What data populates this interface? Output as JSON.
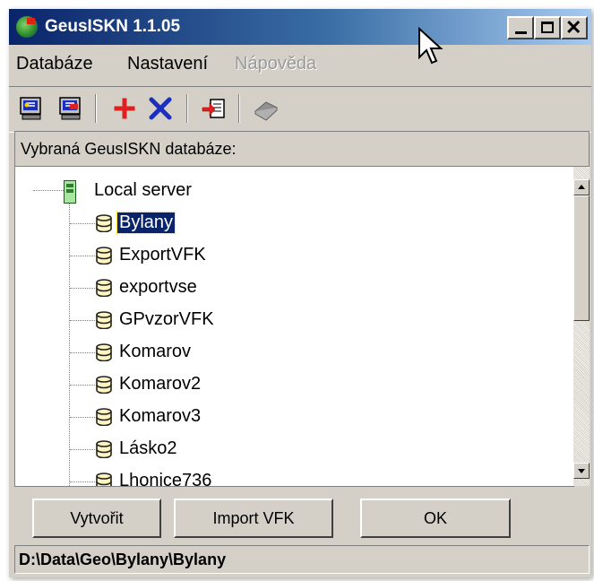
{
  "window": {
    "title": "GeusISKN 1.1.05"
  },
  "menu": [
    {
      "label": "Databáze",
      "enabled": true
    },
    {
      "label": "Nastavení",
      "enabled": true
    },
    {
      "label": "Nápověda",
      "enabled": false
    }
  ],
  "toolbar": {
    "icons": [
      "connect-db-icon",
      "disconnect-db-icon",
      "add-icon",
      "delete-icon",
      "import-icon",
      "book-icon"
    ]
  },
  "panel": {
    "header": "Vybraná GeusISKN databáze:"
  },
  "tree": {
    "root": {
      "label": "Local server",
      "icon": "server-icon"
    },
    "items": [
      {
        "label": "Bylany",
        "selected": true
      },
      {
        "label": "ExportVFK",
        "selected": false
      },
      {
        "label": "exportvse",
        "selected": false
      },
      {
        "label": "GPvzorVFK",
        "selected": false
      },
      {
        "label": "Komarov",
        "selected": false
      },
      {
        "label": "Komarov2",
        "selected": false
      },
      {
        "label": "Komarov3",
        "selected": false
      },
      {
        "label": "Lásko2",
        "selected": false
      },
      {
        "label": "Lhonice736",
        "selected": false
      }
    ]
  },
  "buttons": {
    "create": "Vytvořit",
    "import": "Import VFK",
    "ok": "OK"
  },
  "status": {
    "path": "D:\\Data\\Geo\\Bylany\\Bylany"
  },
  "colors": {
    "selection": "#0a246a",
    "titlebar_start": "#0a246a",
    "face": "#d4d0c8",
    "add_icon": "#e02020",
    "delete_icon": "#1a2fc0"
  }
}
